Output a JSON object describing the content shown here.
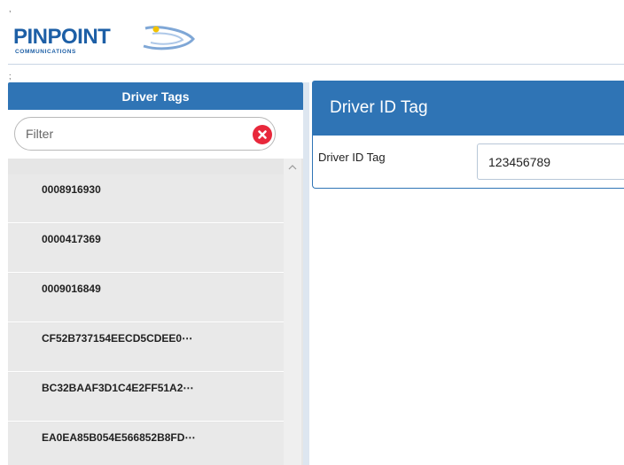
{
  "header": {
    "logo_text": "PINPOINT",
    "logo_subtext": "COMMUNICATIONS",
    "tick_top": ",",
    "tick_bottom": ";"
  },
  "left_panel": {
    "title": "Driver Tags",
    "filter": {
      "placeholder": "Filter",
      "value": ""
    },
    "items": [
      {
        "label": "0008916930"
      },
      {
        "label": "0000417369"
      },
      {
        "label": "0009016849"
      },
      {
        "label": "CF52B737154EECD5CDEE0⋯"
      },
      {
        "label": "BC32BAAF3D1C4E2FF51A2⋯"
      },
      {
        "label": "EA0EA85B054E566852B8FD⋯"
      }
    ]
  },
  "right_panel": {
    "title": "Driver ID Tag",
    "field_label": "Driver ID Tag",
    "field_value": "123456789"
  },
  "colors": {
    "accent": "#2f74b5",
    "logo": "#1d5fa6",
    "clear": "#e8283b"
  },
  "icons": [
    "pinpoint-logo-icon",
    "clear-filter-icon",
    "scroll-up-icon"
  ]
}
